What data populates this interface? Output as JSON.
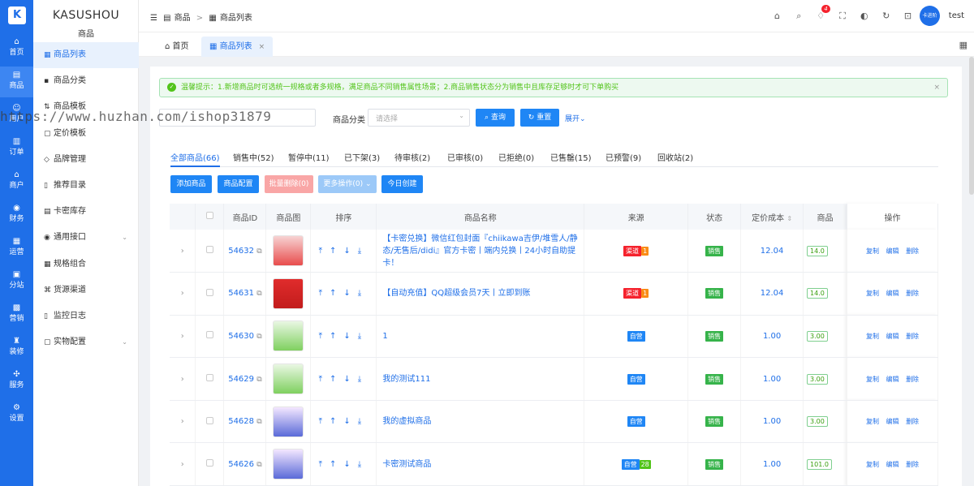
{
  "rail": {
    "items": [
      {
        "label": "首页",
        "icon": "home-icon"
      },
      {
        "label": "商品",
        "icon": "goods-icon"
      },
      {
        "label": "用户",
        "icon": "user-icon"
      },
      {
        "label": "订单",
        "icon": "order-icon"
      },
      {
        "label": "商户",
        "icon": "shop-icon"
      },
      {
        "label": "财务",
        "icon": "finance-icon"
      },
      {
        "label": "运营",
        "icon": "operation-icon"
      },
      {
        "label": "分站",
        "icon": "substation-icon"
      },
      {
        "label": "营销",
        "icon": "marketing-icon"
      },
      {
        "label": "装修",
        "icon": "decorate-icon"
      },
      {
        "label": "服务",
        "icon": "service-icon"
      },
      {
        "label": "设置",
        "icon": "settings-icon"
      }
    ]
  },
  "sidebar": {
    "brand": "KASUSHOU",
    "section": "商品",
    "items": [
      {
        "label": "商品列表"
      },
      {
        "label": "商品分类"
      },
      {
        "label": "商品模板"
      },
      {
        "label": "定价模板"
      },
      {
        "label": "品牌管理"
      },
      {
        "label": "推荐目录"
      },
      {
        "label": "卡密库存"
      },
      {
        "label": "通用接口"
      },
      {
        "label": "规格组合"
      },
      {
        "label": "货源渠道"
      },
      {
        "label": "监控日志"
      },
      {
        "label": "实物配置"
      }
    ]
  },
  "header": {
    "crumb1": "商品",
    "sep": ">",
    "crumb2": "商品列表",
    "notify_count": "4",
    "avatar_text": "卡进阶",
    "user": "test"
  },
  "tabs": {
    "home": "首页",
    "current": "商品列表",
    "close": "×"
  },
  "alert": {
    "text": "温馨提示：1.新增商品时可选统一规格或者多规格，满足商品不同销售属性场景；2.商品销售状态分为销售中且库存足够时才可下单购买",
    "close": "×"
  },
  "watermark": "https://www.huzhan.com/ishop31879",
  "filters": {
    "category_label": "商品分类",
    "category_placeholder": "请选择",
    "query": "查询",
    "reset": "重置",
    "expand": "展开"
  },
  "status_tabs": [
    "全部商品(66)",
    "销售中(52)",
    "暂停中(11)",
    "已下架(3)",
    "待审核(2)",
    "已审核(0)",
    "已拒绝(0)",
    "已售罄(15)",
    "已预警(9)",
    "回收站(2)"
  ],
  "actions": {
    "add": "添加商品",
    "config": "商品配置",
    "batch_delete": "批量删除(0)",
    "more": "更多操作(0)",
    "today": "今日创建"
  },
  "table": {
    "headers": [
      "",
      "",
      "商品ID",
      "商品图",
      "排序",
      "商品名称",
      "来源",
      "状态",
      "定价成本",
      "商品",
      "操作"
    ],
    "rows": [
      {
        "id": "54632",
        "name": "【卡密兑换】微信红包封面『chiikawa吉伊/堆雪人/静态/无售后/didi』官方卡密丨端内兑换丨24小时自助提卡！",
        "source": "渠道",
        "source_count": "1",
        "status": "销售",
        "cost": "12.04",
        "price": "14.0"
      },
      {
        "id": "54631",
        "name": "【自动充值】QQ超级会员7天丨立即到账",
        "source": "渠道",
        "source_count": "1",
        "status": "销售",
        "cost": "12.04",
        "price": "14.0"
      },
      {
        "id": "54630",
        "name": "1",
        "source": "自营",
        "source_count": "",
        "status": "销售",
        "cost": "1.00",
        "price": "3.00"
      },
      {
        "id": "54629",
        "name": "我的测试111",
        "source": "自营",
        "source_count": "",
        "status": "销售",
        "cost": "1.00",
        "price": "3.00"
      },
      {
        "id": "54628",
        "name": "我的虚拟商品",
        "source": "自营",
        "source_count": "",
        "status": "销售",
        "cost": "1.00",
        "price": "3.00"
      },
      {
        "id": "54626",
        "name": "卡密测试商品",
        "source": "自营",
        "source_count": "28",
        "status": "销售",
        "cost": "1.00",
        "price": "101.0"
      }
    ],
    "ops": {
      "copy": "复制",
      "edit": "编辑",
      "delete": "删除"
    }
  },
  "colors": {
    "primary": "#1f6fe8",
    "success": "#52c41a",
    "danger": "#f5222d"
  }
}
